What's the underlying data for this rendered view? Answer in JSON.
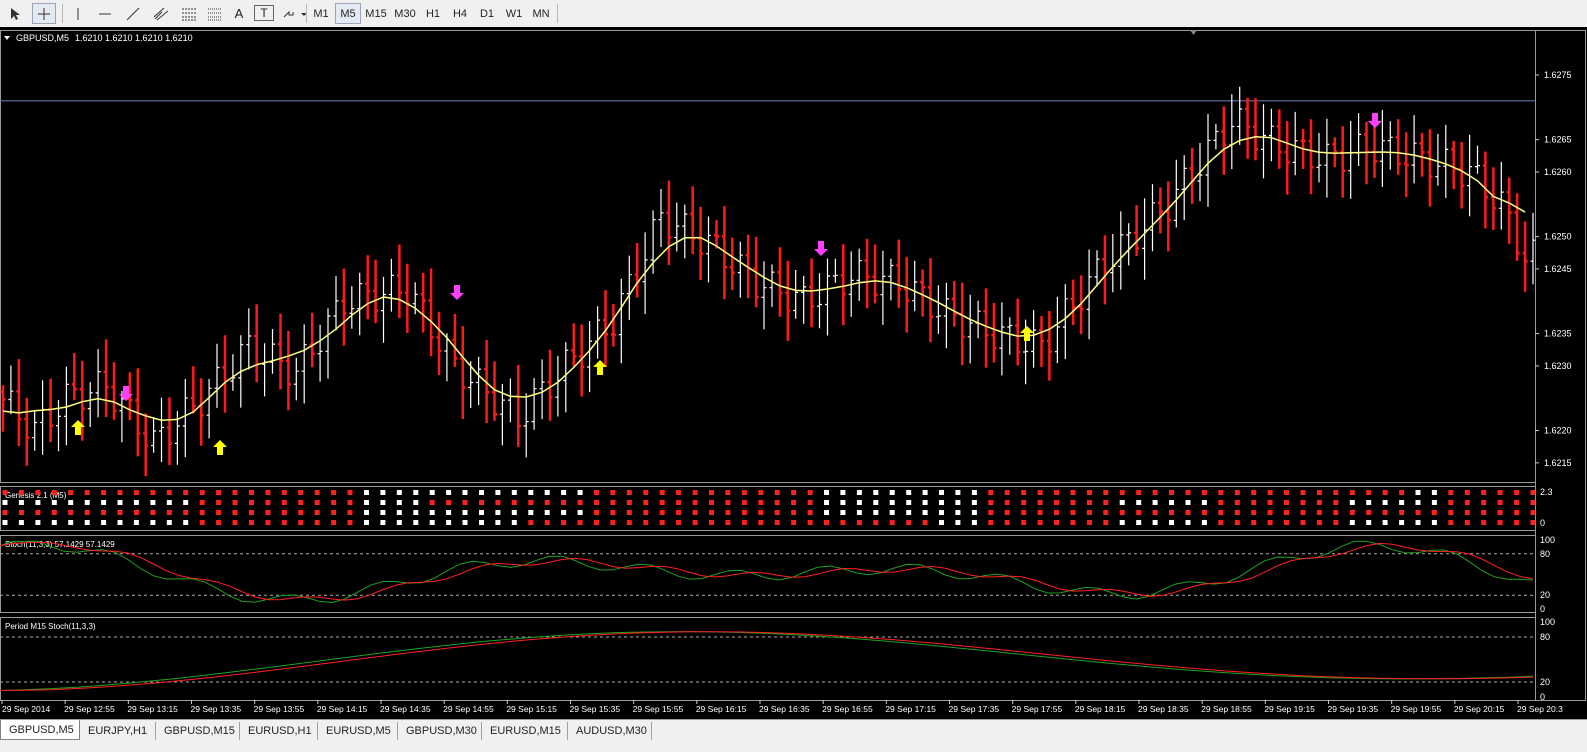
{
  "toolbar": {
    "tools": [
      {
        "name": "cursor-tool-button",
        "icon": "cursor-icon"
      },
      {
        "name": "crosshair-tool-button",
        "icon": "crosshair-icon"
      },
      {
        "name": "vertical-line-tool-button",
        "icon": "vertical-line-icon"
      },
      {
        "name": "horizontal-line-tool-button",
        "icon": "horizontal-line-icon"
      },
      {
        "name": "trendline-tool-button",
        "icon": "trendline-icon"
      },
      {
        "name": "equidistant-channel-tool-button",
        "icon": "channel-icon"
      },
      {
        "name": "fibonacci-tool-button",
        "icon": "fibonacci-icon"
      },
      {
        "name": "text-tool-button",
        "label": "A"
      },
      {
        "name": "text-label-tool-button",
        "label": "T"
      },
      {
        "name": "arrows-tool-button",
        "icon": "arrows-icon"
      }
    ],
    "periods": [
      "M1",
      "M5",
      "M15",
      "M30",
      "H1",
      "H4",
      "D1",
      "W1",
      "MN"
    ],
    "active_period": "M5"
  },
  "main_chart": {
    "title": "GBPUSD,M5",
    "quote": "1.6210 1.6210 1.6210 1.6210",
    "price_labels": [
      "1.6275",
      "1.6265",
      "1.6260",
      "1.6250",
      "1.6245",
      "1.6235",
      "1.6230",
      "1.6220",
      "1.6215"
    ],
    "price_range": [
      1.62125,
      1.62815
    ],
    "horizontal_line_level": 1.6271,
    "colors": {
      "bull": "#ffffff",
      "bear": "#ff1a1a",
      "ma": "#ffff80",
      "buy_arrow": "#ffff00",
      "sell_arrow": "#ff40ff",
      "hline": "#7080c0"
    }
  },
  "genesis": {
    "title": "Genesis 2.1 (M5)",
    "scale_labels": [
      "2.3",
      "0"
    ]
  },
  "stoch1": {
    "title": "Stoch(11,3,3) 57.1429 57.1429",
    "scale_labels": [
      "100",
      "80",
      "20",
      "0"
    ]
  },
  "stoch2": {
    "title": "Period M15 Stoch(11,3,3)",
    "scale_labels": [
      "100",
      "80",
      "20",
      "0"
    ]
  },
  "time_axis": [
    "29 Sep 2014",
    "29 Sep 12:55",
    "29 Sep 13:15",
    "29 Sep 13:35",
    "29 Sep 13:55",
    "29 Sep 14:15",
    "29 Sep 14:35",
    "29 Sep 14:55",
    "29 Sep 15:15",
    "29 Sep 15:35",
    "29 Sep 15:55",
    "29 Sep 16:15",
    "29 Sep 16:35",
    "29 Sep 16:55",
    "29 Sep 17:15",
    "29 Sep 17:35",
    "29 Sep 17:55",
    "29 Sep 18:15",
    "29 Sep 18:35",
    "29 Sep 18:55",
    "29 Sep 19:15",
    "29 Sep 19:35",
    "29 Sep 19:55",
    "29 Sep 20:15",
    "29 Sep 20:3"
  ],
  "tabs": [
    "GBPUSD,M5",
    "EURJPY,H1",
    "GBPUSD,M15",
    "EURUSD,H1",
    "EURUSD,M5",
    "GBPUSD,M30",
    "EURUSD,M15",
    "AUDUSD,M30"
  ],
  "active_tab": "GBPUSD,M5"
}
